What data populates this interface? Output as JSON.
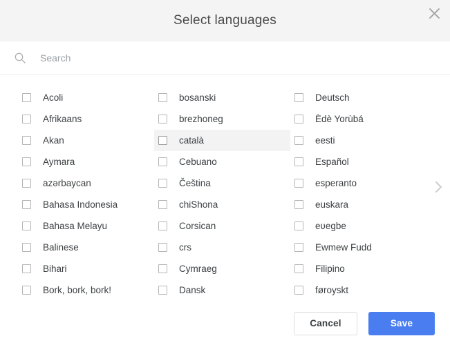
{
  "dialog": {
    "title": "Select languages",
    "close_icon": "close-icon"
  },
  "search": {
    "icon": "search-icon",
    "placeholder": "Search",
    "value": ""
  },
  "pagination": {
    "next_icon": "chevron-right-icon"
  },
  "languages": {
    "hovered": "català",
    "columns": [
      {
        "items": [
          {
            "label": "Acoli",
            "checked": false
          },
          {
            "label": "Afrikaans",
            "checked": false
          },
          {
            "label": "Akan",
            "checked": false
          },
          {
            "label": "Aymara",
            "checked": false
          },
          {
            "label": "azərbaycan",
            "checked": false
          },
          {
            "label": "Bahasa Indonesia",
            "checked": false
          },
          {
            "label": "Bahasa Melayu",
            "checked": false
          },
          {
            "label": "Balinese",
            "checked": false
          },
          {
            "label": "Bihari",
            "checked": false
          },
          {
            "label": "Bork, bork, bork!",
            "checked": false
          }
        ]
      },
      {
        "items": [
          {
            "label": "bosanski",
            "checked": false
          },
          {
            "label": "brezhoneg",
            "checked": false
          },
          {
            "label": "català",
            "checked": false
          },
          {
            "label": "Cebuano",
            "checked": false
          },
          {
            "label": "Čeština",
            "checked": false
          },
          {
            "label": "chiShona",
            "checked": false
          },
          {
            "label": "Corsican",
            "checked": false
          },
          {
            "label": "crs",
            "checked": false
          },
          {
            "label": "Cymraeg",
            "checked": false
          },
          {
            "label": "Dansk",
            "checked": false
          }
        ]
      },
      {
        "items": [
          {
            "label": "Deutsch",
            "checked": false
          },
          {
            "label": "Èdè Yorùbá",
            "checked": false
          },
          {
            "label": "eesti",
            "checked": false
          },
          {
            "label": "Español",
            "checked": false
          },
          {
            "label": "esperanto",
            "checked": false
          },
          {
            "label": "euskara",
            "checked": false
          },
          {
            "label": "eʋegbe",
            "checked": false
          },
          {
            "label": "Ewmew Fudd",
            "checked": false
          },
          {
            "label": "Filipino",
            "checked": false
          },
          {
            "label": "føroyskt",
            "checked": false
          }
        ]
      }
    ]
  },
  "footer": {
    "cancel_label": "Cancel",
    "save_label": "Save"
  },
  "colors": {
    "header_bg": "#f4f4f4",
    "title_text": "#4a4a4a",
    "save_bg": "#4a7ef0",
    "save_text": "#ffffff",
    "cancel_border": "#dcdcdc",
    "row_hover_bg": "#f3f3f3",
    "label_text": "#3c4043",
    "placeholder_text": "#9aa0a6"
  }
}
